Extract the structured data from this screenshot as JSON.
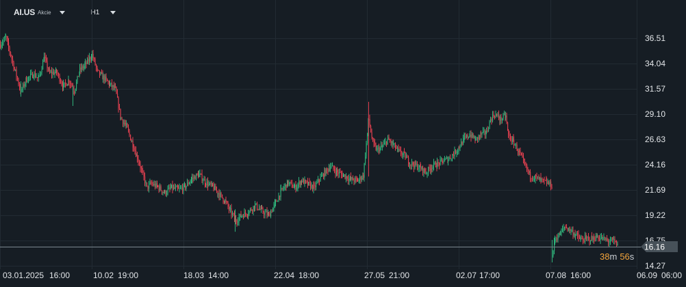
{
  "header": {
    "symbol": "AI.US",
    "symbol_type": "Akcie",
    "timeframe": "H1"
  },
  "countdown": {
    "minutes": "38",
    "minutes_unit": "m",
    "seconds": "56",
    "seconds_unit": "s"
  },
  "colors": {
    "background": "#161d24",
    "grid": "#222b33",
    "up": "#2fb27a",
    "down": "#e2404f",
    "price_tag": "#475159",
    "countdown": "#f3a43b"
  },
  "chart_data": {
    "type": "candlestick",
    "timeframe": "H1",
    "current_price": "16.16",
    "y_ticks": [
      "36.51",
      "34.04",
      "31.57",
      "29.10",
      "26.63",
      "24.16",
      "21.69",
      "19.22",
      "16.75",
      "14.27"
    ],
    "ylim": [
      14.27,
      36.51
    ],
    "x_ticks": [
      "03.01.2025",
      "16:00",
      "10.02",
      "19:00",
      "18.03",
      "14:00",
      "22.04",
      "18:00",
      "27.05",
      "21:00",
      "02.07",
      "17:00",
      "07.08",
      "16:00",
      "06.09",
      "06:00"
    ],
    "grid": true,
    "price_path": [
      [
        0,
        35.9
      ],
      [
        8,
        36.6
      ],
      [
        12,
        35.6
      ],
      [
        22,
        33.2
      ],
      [
        30,
        31.3
      ],
      [
        38,
        32.5
      ],
      [
        48,
        33.0
      ],
      [
        56,
        32.6
      ],
      [
        64,
        34.6
      ],
      [
        72,
        33.1
      ],
      [
        82,
        33.2
      ],
      [
        92,
        31.8
      ],
      [
        100,
        32.4
      ],
      [
        108,
        31.4
      ],
      [
        116,
        33.4
      ],
      [
        124,
        33.9
      ],
      [
        134,
        34.9
      ],
      [
        142,
        33.2
      ],
      [
        150,
        32.7
      ],
      [
        160,
        32.0
      ],
      [
        168,
        31.5
      ],
      [
        176,
        28.7
      ],
      [
        184,
        27.9
      ],
      [
        192,
        26.4
      ],
      [
        200,
        24.9
      ],
      [
        208,
        23.2
      ],
      [
        214,
        21.9
      ],
      [
        220,
        22.3
      ],
      [
        230,
        22.0
      ],
      [
        240,
        21.4
      ],
      [
        250,
        21.9
      ],
      [
        260,
        21.7
      ],
      [
        270,
        22.0
      ],
      [
        280,
        22.8
      ],
      [
        290,
        23.2
      ],
      [
        300,
        22.4
      ],
      [
        310,
        22.0
      ],
      [
        318,
        21.4
      ],
      [
        328,
        20.6
      ],
      [
        336,
        19.6
      ],
      [
        344,
        18.7
      ],
      [
        352,
        19.2
      ],
      [
        362,
        19.5
      ],
      [
        372,
        20.2
      ],
      [
        382,
        19.6
      ],
      [
        392,
        19.2
      ],
      [
        402,
        20.4
      ],
      [
        410,
        21.6
      ],
      [
        420,
        22.4
      ],
      [
        430,
        21.9
      ],
      [
        440,
        22.6
      ],
      [
        450,
        22.2
      ],
      [
        458,
        21.9
      ],
      [
        466,
        22.7
      ],
      [
        474,
        23.4
      ],
      [
        482,
        24.0
      ],
      [
        492,
        23.4
      ],
      [
        502,
        23.1
      ],
      [
        512,
        22.7
      ],
      [
        522,
        22.6
      ],
      [
        530,
        23.1
      ],
      [
        538,
        28.6
      ],
      [
        544,
        26.2
      ],
      [
        550,
        25.6
      ],
      [
        558,
        25.9
      ],
      [
        566,
        26.6
      ],
      [
        574,
        26.1
      ],
      [
        582,
        25.4
      ],
      [
        590,
        25.1
      ],
      [
        598,
        24.3
      ],
      [
        606,
        24.1
      ],
      [
        614,
        23.8
      ],
      [
        622,
        23.4
      ],
      [
        630,
        24.0
      ],
      [
        638,
        24.2
      ],
      [
        646,
        24.5
      ],
      [
        654,
        24.7
      ],
      [
        662,
        25.2
      ],
      [
        670,
        25.9
      ],
      [
        678,
        26.7
      ],
      [
        686,
        27.1
      ],
      [
        694,
        26.6
      ],
      [
        702,
        27.1
      ],
      [
        710,
        27.3
      ],
      [
        716,
        28.6
      ],
      [
        722,
        29.1
      ],
      [
        730,
        28.6
      ],
      [
        738,
        28.9
      ],
      [
        742,
        27.0
      ],
      [
        750,
        26.3
      ],
      [
        758,
        25.3
      ],
      [
        766,
        24.1
      ],
      [
        774,
        23.1
      ],
      [
        782,
        22.9
      ],
      [
        790,
        22.6
      ],
      [
        798,
        22.4
      ],
      [
        806,
        22.1
      ],
      [
        806,
        15.2
      ],
      [
        810,
        16.9
      ],
      [
        818,
        17.4
      ],
      [
        824,
        18.1
      ],
      [
        832,
        17.8
      ],
      [
        840,
        17.3
      ],
      [
        848,
        16.8
      ],
      [
        856,
        16.9
      ],
      [
        864,
        16.9
      ],
      [
        872,
        17.1
      ],
      [
        880,
        16.9
      ],
      [
        888,
        16.7
      ],
      [
        896,
        16.7
      ],
      [
        900,
        16.4
      ],
      [
        902,
        16.16
      ]
    ]
  }
}
